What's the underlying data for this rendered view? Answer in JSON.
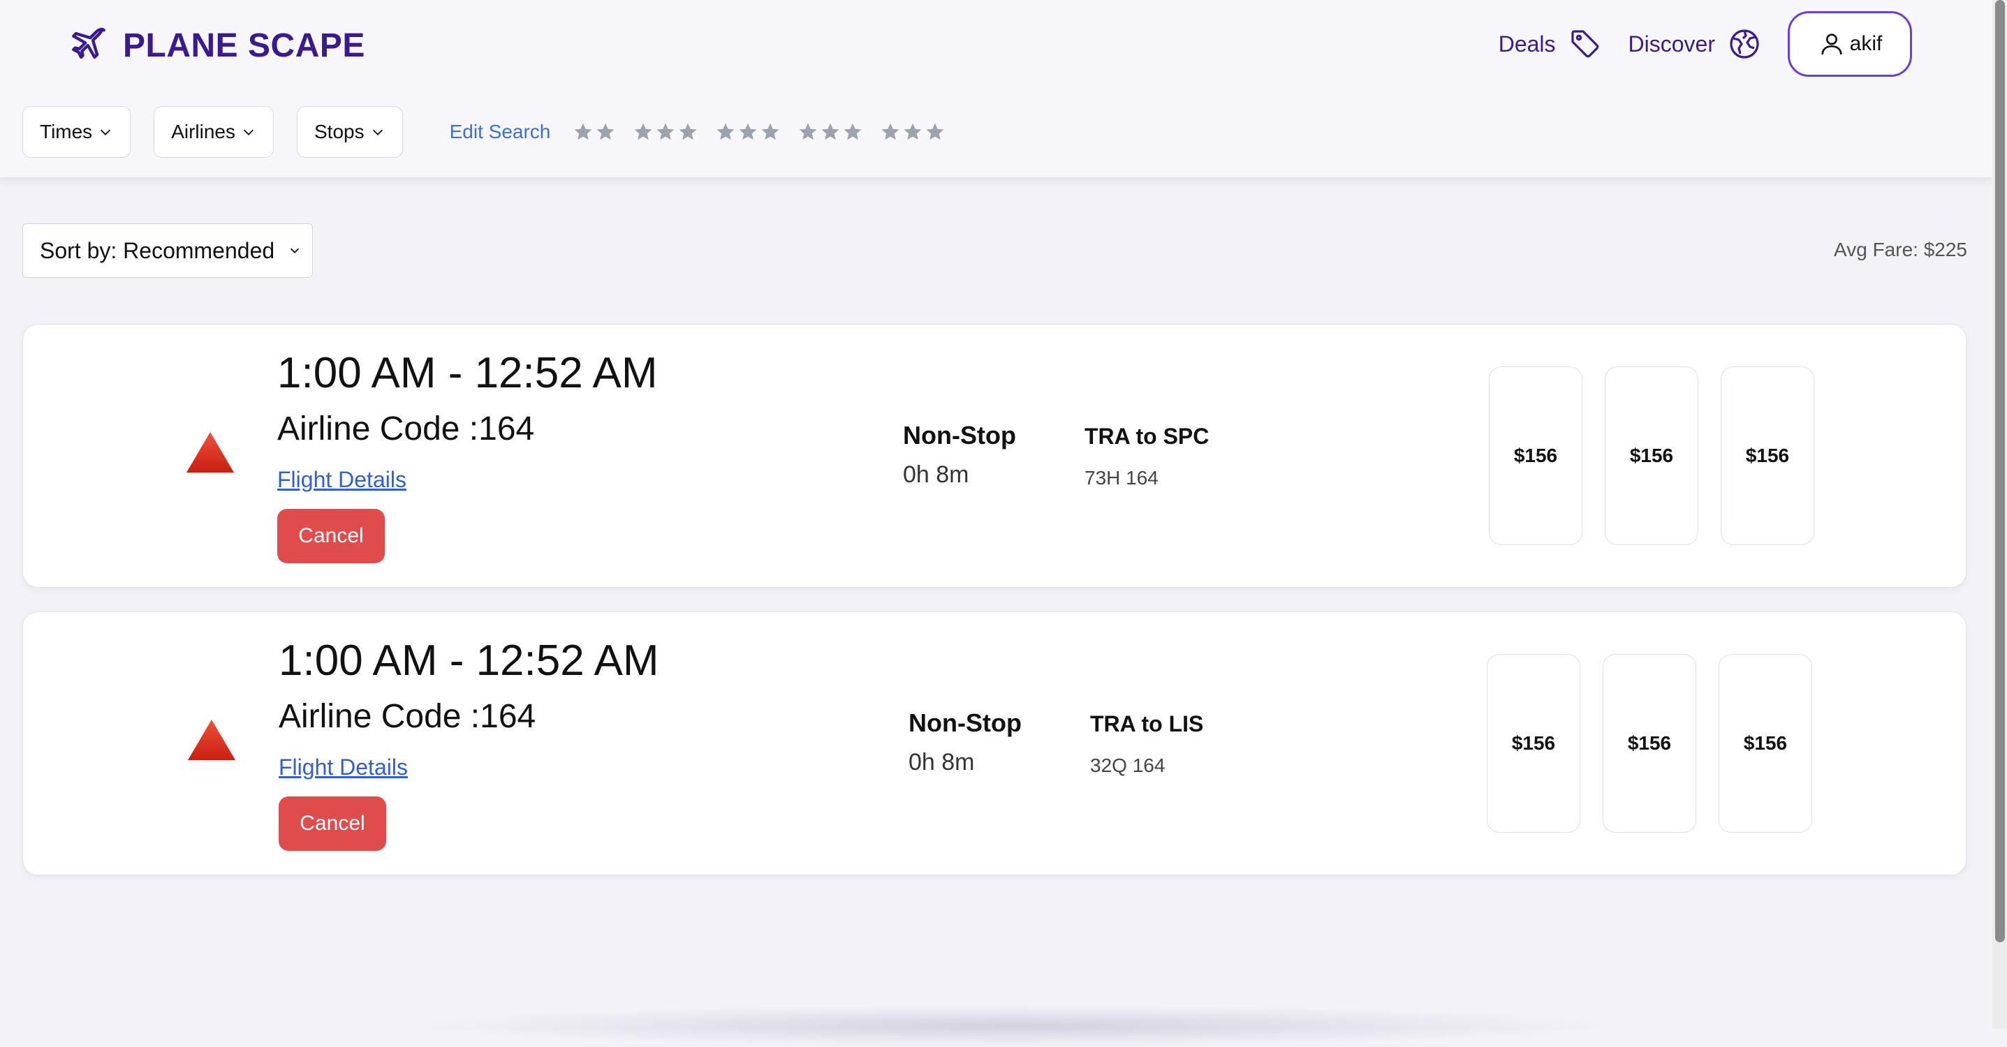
{
  "header": {
    "brand_name": "PLANE SCAPE",
    "nav": {
      "deals_label": "Deals",
      "discover_label": "Discover",
      "user_label": "akif"
    },
    "brand_color": "#3b1a8f"
  },
  "filters": {
    "times_label": "Times",
    "airlines_label": "Airlines",
    "stops_label": "Stops",
    "edit_search_label": "Edit Search",
    "star_groups": [
      2,
      3,
      3,
      3,
      3
    ]
  },
  "sort": {
    "label": "Sort by: Recommended"
  },
  "avg_fare": "Avg Fare: $225",
  "flights": [
    {
      "times": "1:00 AM - 12:52 AM",
      "airline": "Airline Code :164",
      "details_label": "Flight Details",
      "cancel_label": "Cancel",
      "stops": "Non-Stop",
      "duration": "0h 8m",
      "route": "TRA to SPC",
      "flight_no": "73H 164",
      "fares": [
        "$156",
        "$156",
        "$156"
      ]
    },
    {
      "times": "1:00 AM - 12:52 AM",
      "airline": "Airline Code :164",
      "details_label": "Flight Details",
      "cancel_label": "Cancel",
      "stops": "Non-Stop",
      "duration": "0h 8m",
      "route": "TRA to LIS",
      "flight_no": "32Q 164",
      "fares": [
        "$156",
        "$156",
        "$156"
      ]
    }
  ],
  "icons": {
    "brand": "airplane-icon",
    "deals": "tag-icon",
    "discover": "globe-icon",
    "user": "user-icon",
    "flight_status": "warning-triangle-icon"
  },
  "colors": {
    "accent": "#3b1a8f",
    "cancel": "#e04c4c",
    "link": "#2f5fd1"
  }
}
